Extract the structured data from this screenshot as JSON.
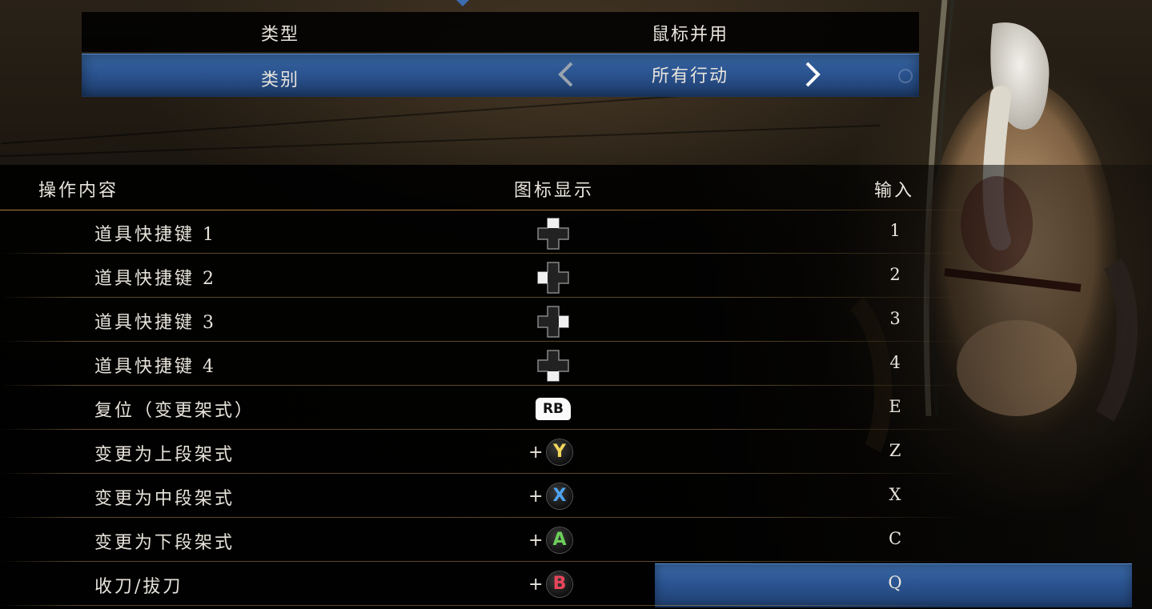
{
  "settings": {
    "type_label": "类型",
    "type_value": "鼠标并用",
    "category_label": "类别",
    "category_value": "所有行动"
  },
  "table": {
    "header_action": "操作内容",
    "header_icon": "图标显示",
    "header_input": "输入",
    "rows": [
      {
        "action": "道具快捷键 1",
        "icon": "dpad-up-icon",
        "key": "1"
      },
      {
        "action": "道具快捷键 2",
        "icon": "dpad-left-icon",
        "key": "2"
      },
      {
        "action": "道具快捷键 3",
        "icon": "dpad-right-icon",
        "key": "3"
      },
      {
        "action": "道具快捷键 4",
        "icon": "dpad-down-icon",
        "key": "4"
      },
      {
        "action": "复位（变更架式）",
        "icon": "rb-button-icon",
        "button": "RB",
        "key": "E"
      },
      {
        "action": "变更为上段架式",
        "icon": "y-button-icon",
        "plus": "+",
        "button": "Y",
        "button_color": "#f2d75a",
        "key": "Z"
      },
      {
        "action": "变更为中段架式",
        "icon": "x-button-icon",
        "plus": "+",
        "button": "X",
        "button_color": "#4fa3f0",
        "key": "X"
      },
      {
        "action": "变更为下段架式",
        "icon": "a-button-icon",
        "plus": "+",
        "button": "A",
        "button_color": "#6cd05a",
        "key": "C"
      },
      {
        "action": "收刀/拔刀",
        "icon": "b-button-icon",
        "plus": "+",
        "button": "B",
        "button_color": "#e8455a",
        "key": "Q",
        "selected": true
      }
    ]
  },
  "colors": {
    "highlight_blue": "#2b5490",
    "divider_gold": "#d29646"
  }
}
